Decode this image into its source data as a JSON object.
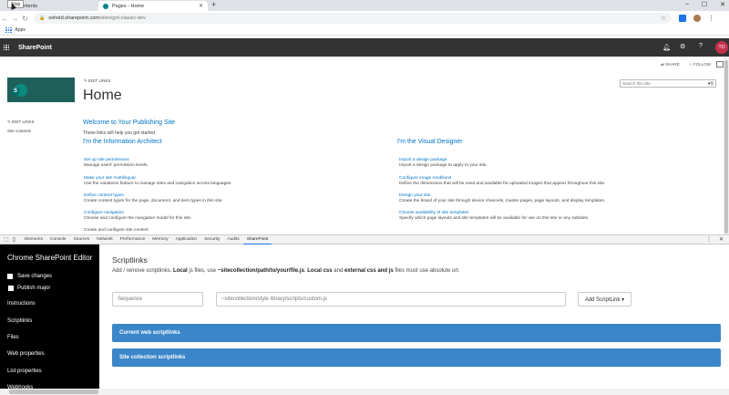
{
  "browser": {
    "tabs": [
      {
        "label": "ontents"
      },
      {
        "label": "Pages - Home"
      }
    ],
    "new_tab": "+",
    "tooltip": "Stop",
    "url_host": "sohotd.sharepoint.com",
    "url_path": "/sites/gnt-classic-dev",
    "bookmarks_label": "Apps",
    "window_controls": [
      "–",
      "☐",
      "✕"
    ]
  },
  "suitebar": {
    "brand": "SharePoint",
    "avatar_initials": "TD"
  },
  "page": {
    "share": "SHARE",
    "follow": "FOLLOW",
    "edit_links": "EDIT LINKS",
    "title": "Home",
    "search_placeholder": "Search this site",
    "left_edit_links": "EDIT LINKS",
    "left_site_contents": "Site contents",
    "welcome": "Welcome to Your Publishing Site",
    "welcome_sub": "These links will help you get started.",
    "col_left_heading": "I'm the Information Architect",
    "col_right_heading": "I'm the Visual Designer",
    "left_links": [
      {
        "title": "Set up site permissions",
        "desc": "Manage users' permission levels."
      },
      {
        "title": "Make your site multilingual",
        "desc": "Use the variations feature to manage sites and navigation across languages."
      },
      {
        "title": "Define content types",
        "desc": "Create content types for the page, document, and item types in this site."
      },
      {
        "title": "Configure navigation",
        "desc": "Choose and configure the navigation model for this site."
      },
      {
        "title": "Create and configure site content",
        "desc": ""
      }
    ],
    "right_links": [
      {
        "title": "Import a design package",
        "desc": "Import a design package to apply to your site."
      },
      {
        "title": "Configure image renditions",
        "desc": "Define the dimensions that will be used and available for uploaded images that appear throughout this site."
      },
      {
        "title": "Design your site",
        "desc": "Create the brand of your site through device channels, master pages, page layouts, and display templates."
      },
      {
        "title": "Choose availability of site templates",
        "desc": "Specify which page layouts and site templates will be available for use on this site or any subsites."
      }
    ]
  },
  "devtools": {
    "tabs": [
      "Elements",
      "Console",
      "Sources",
      "Network",
      "Performance",
      "Memory",
      "Application",
      "Security",
      "Audits",
      "SharePoint"
    ],
    "active_tab": "SharePoint"
  },
  "editor": {
    "title": "Chrome SharePoint Editor",
    "save_changes": "Save changes",
    "publish_major": "Publish major",
    "nav": [
      "Instructions",
      "Scriptlinks",
      "Files",
      "Web properties",
      "List properties",
      "Webhooks"
    ],
    "scriptlinks_title": "Scriptlinks",
    "desc_1": "Add / remove scriptlinks. ",
    "desc_local": "Local",
    "desc_2": " js files, use ",
    "desc_path": "~sitecollection/path/to/your/file.js",
    "desc_3": ". ",
    "desc_local_css": "Local css",
    "desc_4": " and ",
    "desc_external": "external css and js",
    "desc_5": " files must use absolute url.",
    "sequence_placeholder": "Sequence",
    "url_placeholder": "~sitecollection/style library/scripts/custom.js",
    "add_button": "Add ScriptLink ▾",
    "panel_web": "Current web scriptlinks",
    "panel_site": "Site collection scriptlinks"
  }
}
